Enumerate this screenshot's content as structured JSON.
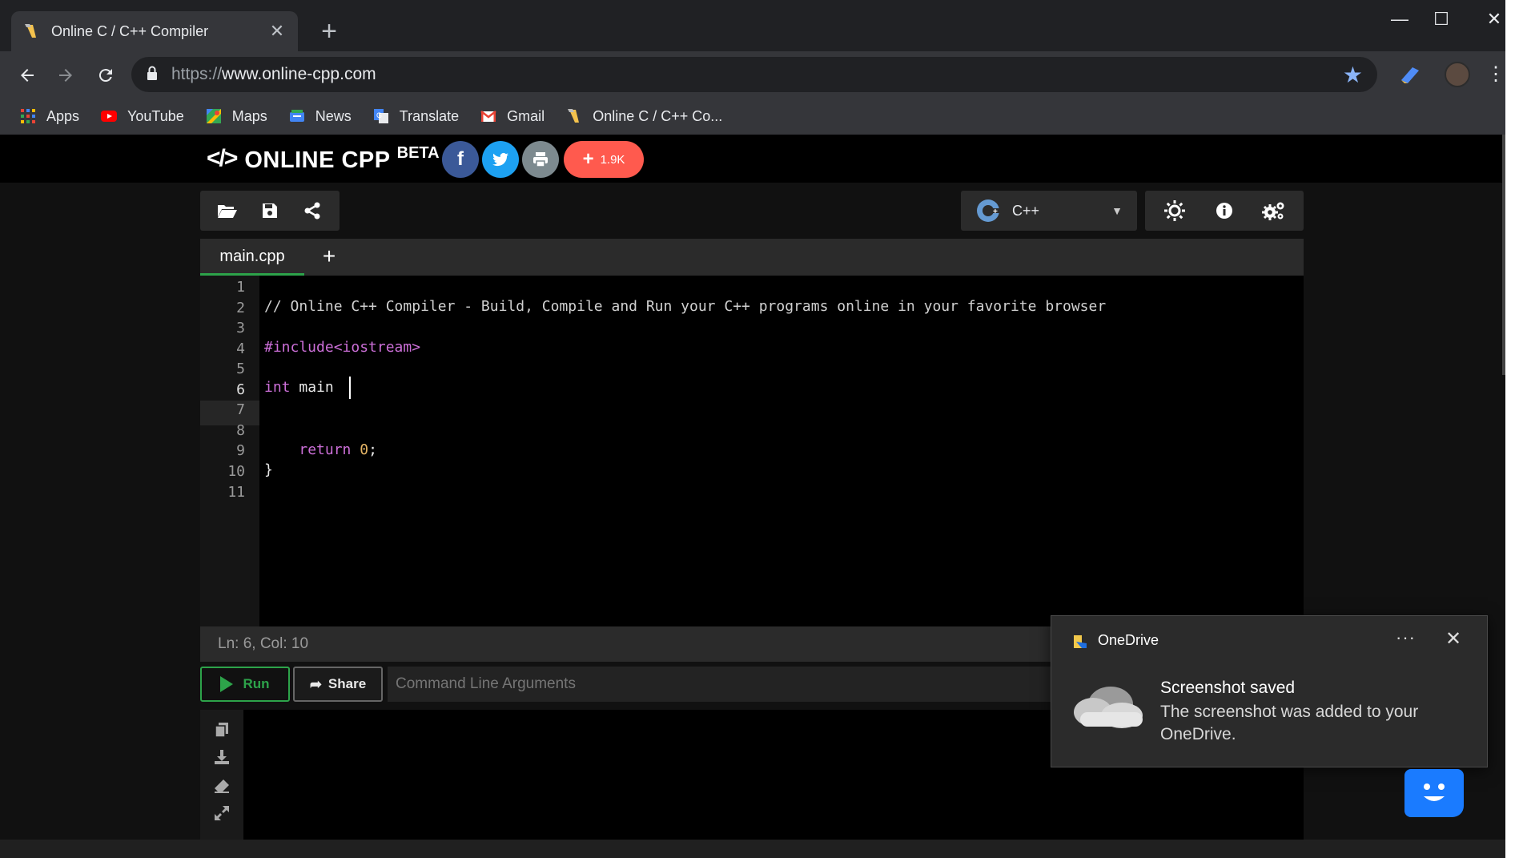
{
  "browser": {
    "tab_title": "Online C / C++ Compiler",
    "tab_close": "✕",
    "new_tab": "+",
    "url_protocol": "https://",
    "url_host": "www.online-cpp.com",
    "window_controls": [
      "—",
      "☐",
      "✕"
    ]
  },
  "bookmarks": [
    {
      "label": "Apps",
      "icon": "apps-grid-icon"
    },
    {
      "label": "YouTube",
      "icon": "youtube-icon"
    },
    {
      "label": "Maps",
      "icon": "maps-icon"
    },
    {
      "label": "News",
      "icon": "news-icon"
    },
    {
      "label": "Translate",
      "icon": "translate-icon"
    },
    {
      "label": "Gmail",
      "icon": "gmail-icon"
    },
    {
      "label": "Online C / C++ Co...",
      "icon": "online-cpp-favicon"
    }
  ],
  "header": {
    "logo_mark": "</>",
    "logo_name": "ONLINE CPP",
    "logo_beta": "BETA",
    "share_count": "1.9K",
    "share_plus": "+"
  },
  "toolbar": {
    "language": "C++"
  },
  "editor": {
    "filename": "main.cpp",
    "add_file": "+",
    "line_numbers": [
      "1",
      "2",
      "3",
      "4",
      "5",
      "6",
      "7",
      "8",
      "9",
      "10",
      "11"
    ],
    "active_line": 6,
    "lines": {
      "l2": "// Online C++ Compiler - Build, Compile and Run your C++ programs online in your favorite browser",
      "l4": "#include<iostream>",
      "l6_kw": "int",
      "l6_rest": " main ",
      "l9_kw": "return",
      "l9_num": "0",
      "l9_end": ";",
      "l10": "}"
    },
    "status": "Ln: 6,  Col: 10"
  },
  "runbar": {
    "run_label": "Run",
    "share_label": "Share",
    "args_placeholder": "Command Line Arguments"
  },
  "toast": {
    "app_name": "OneDrive",
    "more": "···",
    "close": "✕",
    "heading": "Screenshot saved",
    "body": "The screenshot was added to your OneDrive."
  },
  "colors": {
    "accent_green": "#2da34a",
    "facebook": "#3b5998",
    "twitter": "#1da1f2",
    "print": "#7d8a8f",
    "counter": "#ff5a4e",
    "chatbot": "#1a7bff"
  }
}
